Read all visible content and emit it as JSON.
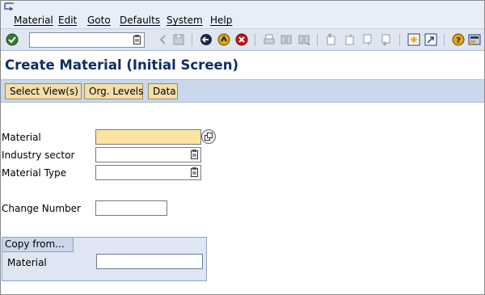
{
  "menubar": {
    "items": [
      {
        "label": "Material"
      },
      {
        "label": "Edit"
      },
      {
        "label": "Goto"
      },
      {
        "label": "Defaults"
      },
      {
        "label": "System"
      },
      {
        "label": "Help"
      }
    ]
  },
  "toolbar": {
    "command_field_value": "",
    "icons": [
      "enter-checkmark-icon",
      "back-icon",
      "save-icon",
      "back-arrow-icon",
      "exit-icon",
      "cancel-icon",
      "print-icon",
      "find-icon",
      "find-next-icon",
      "first-page-icon",
      "previous-page-icon",
      "next-page-icon",
      "last-page-icon",
      "create-session-icon",
      "shortcut-icon",
      "help-icon",
      "customize-layout-icon"
    ]
  },
  "page": {
    "title": "Create Material (Initial Screen)"
  },
  "app_toolbar": {
    "select_views_label": "Select View(s)",
    "org_levels_label": "Org. Levels",
    "data_label": "Data"
  },
  "form": {
    "material_label": "Material",
    "material_value": "",
    "industry_sector_label": "Industry sector",
    "industry_sector_value": "",
    "material_type_label": "Material Type",
    "material_type_value": "",
    "change_number_label": "Change Number",
    "change_number_value": ""
  },
  "copy_from": {
    "title": "Copy from...",
    "material_label": "Material",
    "material_value": ""
  },
  "colors": {
    "title_text": "#0f2d63",
    "app_toolbar_bg": "#c9d8ec",
    "button_bg": "#f3deaa",
    "required_field_bg": "#fbe4a0",
    "group_bg": "#dde6f2"
  }
}
